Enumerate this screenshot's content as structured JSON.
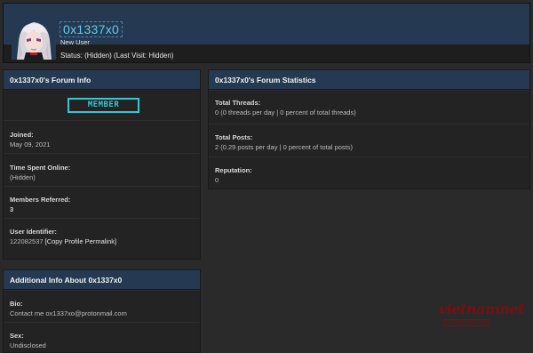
{
  "profile": {
    "username": "0x1337x0",
    "usertitle": "New User",
    "status": "Status: (Hidden) (Last Visit: Hidden)"
  },
  "forum_info": {
    "title": "0x1337x0's Forum Info",
    "rank": "MEMBER",
    "rows": [
      {
        "label": "Joined:",
        "value": "May 09, 2021"
      },
      {
        "label": "Time Spent Online:",
        "value": "(Hidden)"
      },
      {
        "label": "Members Referred:",
        "value": "3"
      },
      {
        "label": "User Identifier:",
        "value": "122082537",
        "link": "[Copy Profile Permalink]"
      }
    ]
  },
  "additional_info": {
    "title": "Additional Info About 0x1337x0",
    "rows": [
      {
        "label": "Bio:",
        "value": "Contact me ox1337xo@protonmail.com"
      },
      {
        "label": "Sex:",
        "value": "Undisclosed"
      }
    ]
  },
  "forum_stats": {
    "title": "0x1337x0's Forum Statistics",
    "rows": [
      {
        "label": "Total Threads:",
        "value": "0 (0 threads per day | 0 percent of total threads)"
      },
      {
        "label": "Total Posts:",
        "value": "2 (0.29 posts per day | 0 percent of total posts)"
      },
      {
        "label": "Reputation:",
        "value": "0"
      }
    ]
  },
  "watermark": {
    "main": "vietnamnet",
    "sub": "VIETNAMNET.VN"
  }
}
